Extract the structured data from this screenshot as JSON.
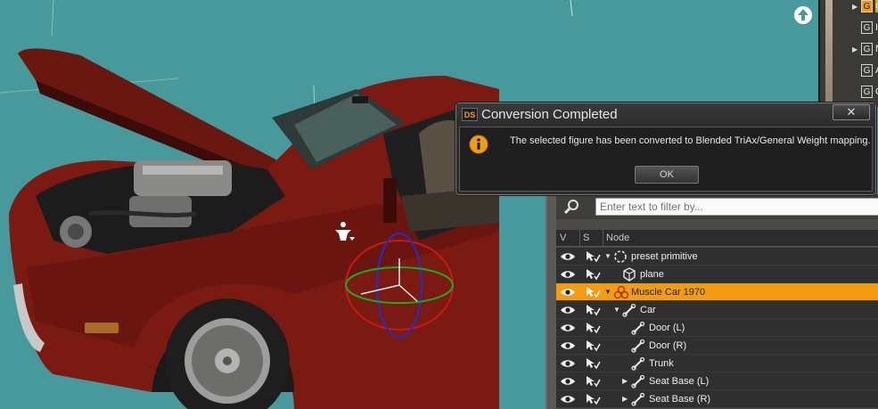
{
  "dialog": {
    "logo": "DS",
    "title": "Conversion Completed",
    "close_label": "✕",
    "message": "The selected figure has been converted to Blended TriAx/General Weight mapping.",
    "ok_label": "OK"
  },
  "top_panel": {
    "items": [
      {
        "box": "G",
        "expandable": true
      },
      {
        "box": "G",
        "expandable": false
      },
      {
        "box": "G",
        "expandable": true
      },
      {
        "box": "G",
        "expandable": false
      },
      {
        "box": "G",
        "expandable": false
      }
    ],
    "cut_text": [
      "C",
      "I",
      "N",
      "A",
      "C"
    ]
  },
  "scene": {
    "filter_placeholder": "Enter text to filter by...",
    "columns": {
      "v": "V",
      "s": "S",
      "node": "Node"
    },
    "rows": [
      {
        "label": "preset primitive",
        "indent": 0,
        "expander": "▼",
        "icon": "null-icon",
        "selected": false
      },
      {
        "label": "plane",
        "indent": 1,
        "expander": "",
        "icon": "cube-icon",
        "selected": false
      },
      {
        "label": "Muscle Car 1970",
        "indent": 0,
        "expander": "▼",
        "icon": "figure-icon",
        "selected": true
      },
      {
        "label": "Car",
        "indent": 1,
        "expander": "▼",
        "icon": "bone-icon",
        "selected": false
      },
      {
        "label": "Door (L)",
        "indent": 2,
        "expander": "",
        "icon": "bone-icon",
        "selected": false
      },
      {
        "label": "Door (R)",
        "indent": 2,
        "expander": "",
        "icon": "bone-icon",
        "selected": false
      },
      {
        "label": "Trunk",
        "indent": 2,
        "expander": "",
        "icon": "bone-icon",
        "selected": false
      },
      {
        "label": "Seat Base (L)",
        "indent": 2,
        "expander": "▶",
        "icon": "bone-icon",
        "selected": false
      },
      {
        "label": "Seat Base (R)",
        "indent": 2,
        "expander": "▶",
        "icon": "bone-icon",
        "selected": false
      }
    ]
  },
  "colors": {
    "viewport_bg": "#47999c",
    "selection": "#f39c12",
    "car_body": "#7a1a12"
  }
}
